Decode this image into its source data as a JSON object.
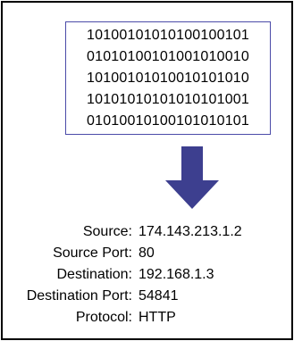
{
  "binary_lines": [
    "10100101010100100101",
    "01010100101001010010",
    "10100101010010101010",
    "10101010101010101001",
    "01010010100101010101"
  ],
  "arrow": {
    "icon": "down-arrow-icon",
    "color": "#3d3f8f"
  },
  "packet_info": [
    {
      "label": "Source:",
      "value": "174.143.213.1.2"
    },
    {
      "label": "Source Port:",
      "value": "80"
    },
    {
      "label": "Destination:",
      "value": "192.168.1.3"
    },
    {
      "label": "Destination Port:",
      "value": "54841"
    },
    {
      "label": "Protocol:",
      "value": "HTTP"
    }
  ]
}
